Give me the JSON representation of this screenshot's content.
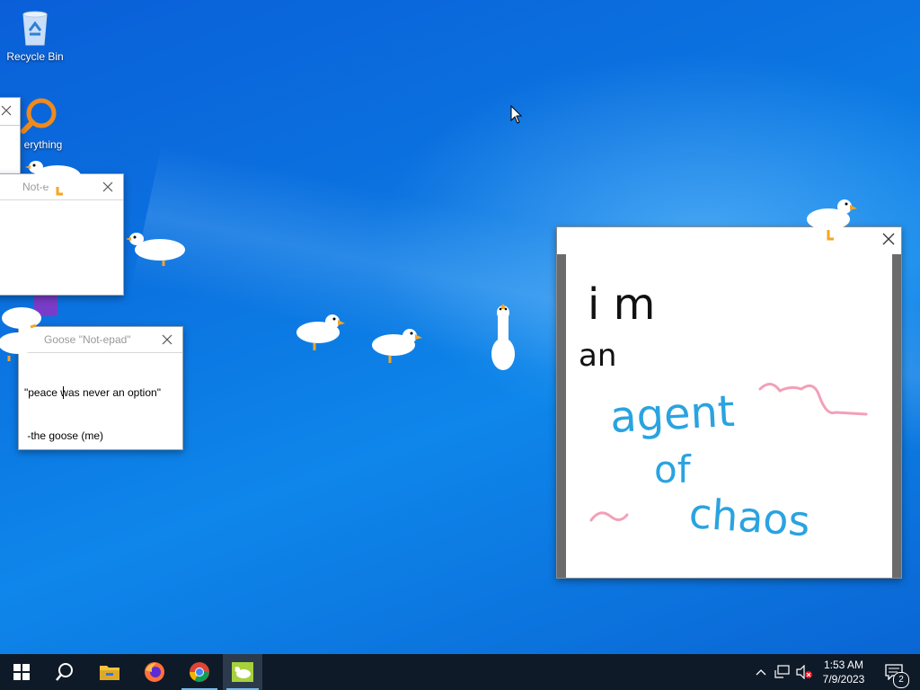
{
  "desktop": {
    "icons": [
      {
        "label": "Recycle Bin",
        "icon": "recycle-bin-icon"
      },
      {
        "label": "erything",
        "icon": "everything-search-icon"
      },
      {
        "label": "",
        "icon": "purple-app-icon"
      }
    ]
  },
  "windows": {
    "note_back": {
      "title": "Not-e"
    },
    "note_front": {
      "title": "Goose \"Not-epad\"",
      "line1": "\"peace was never an option\"",
      "line2": " -the goose (me)"
    },
    "meme": {
      "text_black_1": "i  m",
      "text_black_2": "an",
      "text_blue_1": "agent",
      "text_blue_2": "of",
      "text_blue_3": "chaos"
    }
  },
  "colors": {
    "accent": "#76b9ed",
    "ink_blue": "#2aa3e0",
    "ink_pink": "#f2a0b8",
    "taskbar": "#0f1a28"
  },
  "taskbar": {
    "pinned": [
      {
        "name": "start-button",
        "icon": "windows-logo-icon"
      },
      {
        "name": "search-button",
        "icon": "search-icon"
      },
      {
        "name": "file-explorer",
        "icon": "folder-icon"
      },
      {
        "name": "firefox",
        "icon": "firefox-icon"
      },
      {
        "name": "chrome",
        "icon": "chrome-icon"
      },
      {
        "name": "desktop-goose",
        "icon": "goose-app-icon"
      }
    ],
    "time": "1:53 AM",
    "date": "7/9/2023",
    "notification_count": "2"
  }
}
